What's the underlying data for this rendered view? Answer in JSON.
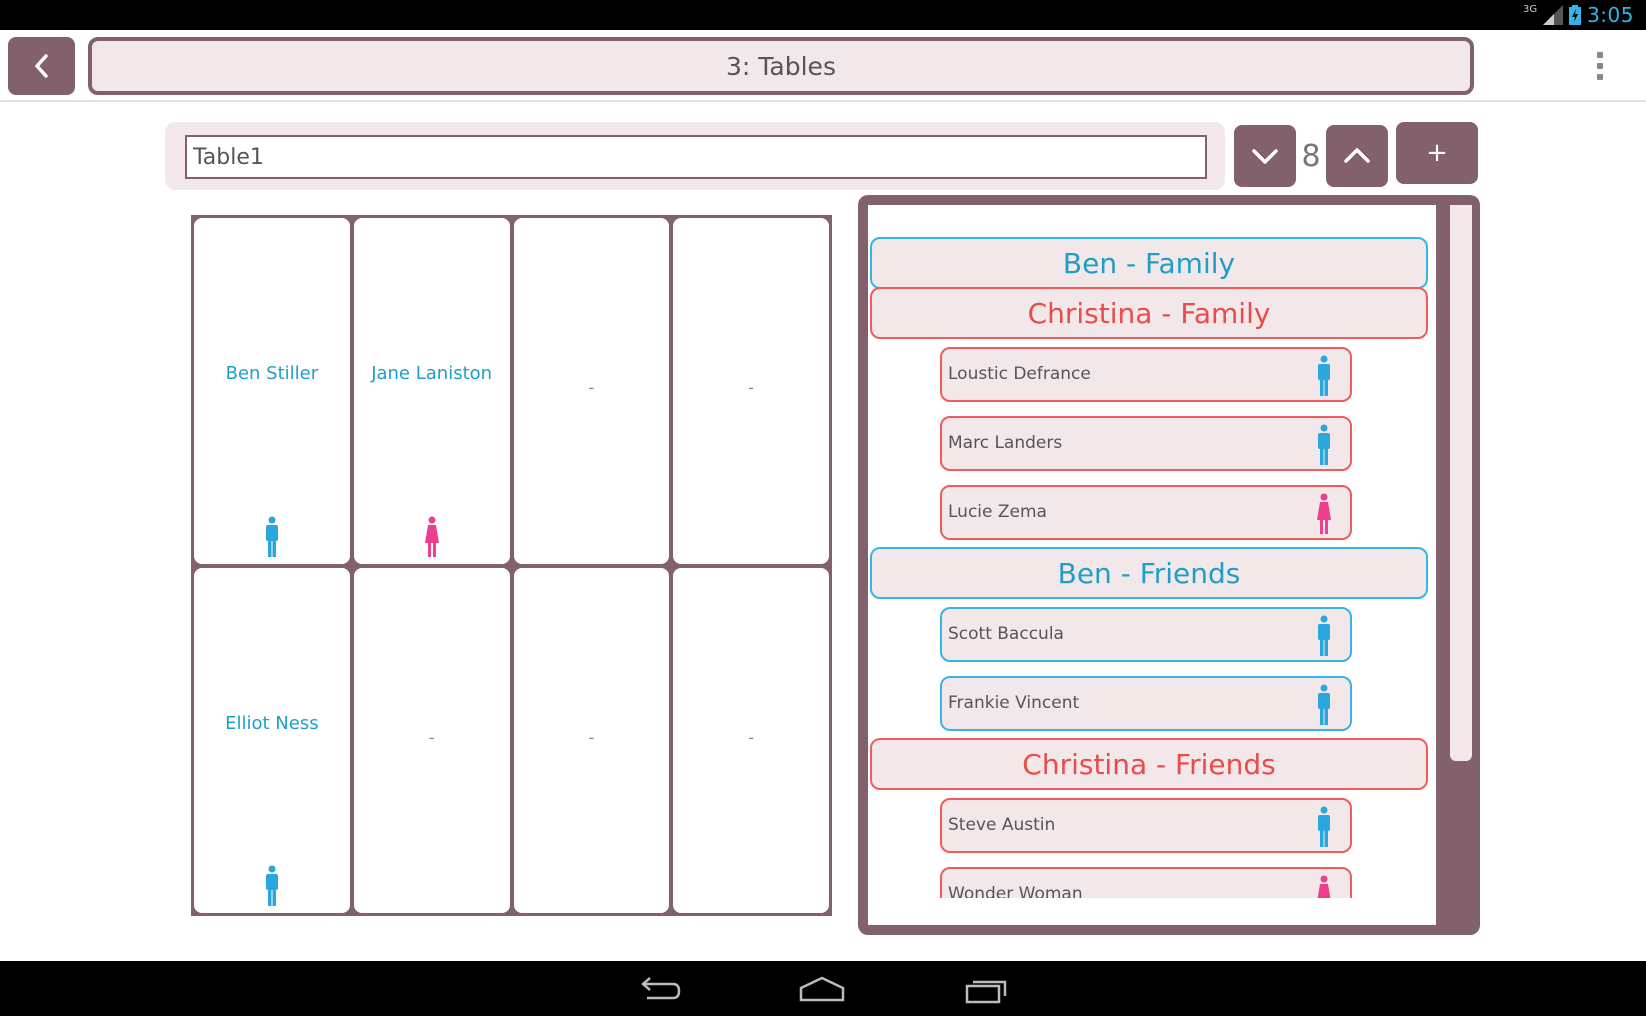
{
  "status_bar": {
    "network": "3G",
    "time": "3:05"
  },
  "action_bar": {
    "title": "3: Tables"
  },
  "table_editor": {
    "name_value": "Table1",
    "seat_count": "8",
    "add_label": "+"
  },
  "seats": [
    {
      "name": "Ben Stiller",
      "gender": "male"
    },
    {
      "name": "Jane Laniston",
      "gender": "female"
    },
    {
      "name": "-",
      "gender": ""
    },
    {
      "name": "-",
      "gender": ""
    },
    {
      "name": "Elliot Ness",
      "gender": "male"
    },
    {
      "name": "-",
      "gender": ""
    },
    {
      "name": "-",
      "gender": ""
    },
    {
      "name": "-",
      "gender": ""
    }
  ],
  "guest_list": {
    "groups": [
      {
        "label": "Ben - Family",
        "color": "blue",
        "guests": []
      },
      {
        "label": "Christina - Family",
        "color": "red",
        "guests": [
          {
            "name": "Loustic Defrance",
            "gender": "male"
          },
          {
            "name": "Marc Landers",
            "gender": "male"
          },
          {
            "name": "Lucie Zema",
            "gender": "female"
          }
        ]
      },
      {
        "label": "Ben - Friends",
        "color": "blue",
        "guests": [
          {
            "name": "Scott Baccula",
            "gender": "male"
          },
          {
            "name": "Frankie Vincent",
            "gender": "male"
          }
        ]
      },
      {
        "label": "Christina - Friends",
        "color": "red",
        "guests": [
          {
            "name": "Steve Austin",
            "gender": "male"
          },
          {
            "name": "Wonder Woman",
            "gender": "female"
          }
        ]
      }
    ]
  },
  "colors": {
    "accent": "#82606c",
    "panel": "#f2e8ea",
    "blue": "#33b5e5",
    "red": "#f25b5b",
    "male_icon": "#2aa7dc",
    "female_icon": "#ee3f8e"
  }
}
